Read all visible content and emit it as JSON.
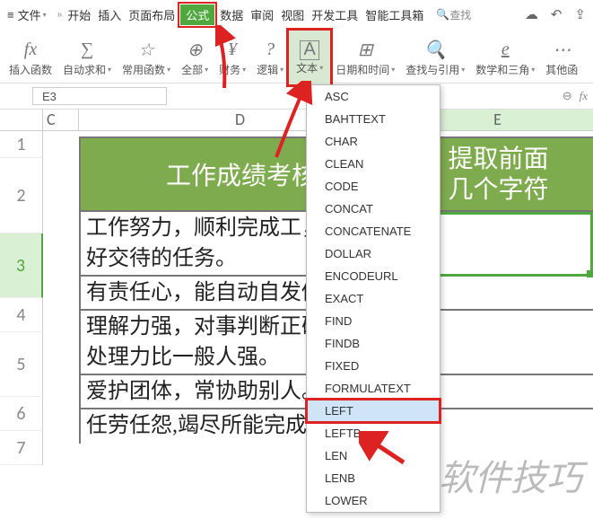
{
  "menubar": {
    "file": "文件",
    "tabs": [
      "开始",
      "插入",
      "页面布局",
      "公式",
      "数据",
      "审阅",
      "视图",
      "开发工具",
      "智能工具箱"
    ],
    "active_tab": "公式",
    "search_placeholder": "查找"
  },
  "ribbon": {
    "insert_fn": "插入函数",
    "auto_sum": "自动求和",
    "recent": "常用函数",
    "all": "全部",
    "finance": "财务",
    "logic": "逻辑",
    "text": "文本",
    "date_time": "日期和时间",
    "lookup": "查找与引用",
    "math": "数学和三角",
    "other": "其他函"
  },
  "name_box": {
    "value": "E3"
  },
  "columns": {
    "c": "C",
    "d": "D",
    "e": "E"
  },
  "row_numbers": [
    "1",
    "2",
    "3",
    "4",
    "5",
    "6",
    "7"
  ],
  "green_header": {
    "d": "工作成绩考核",
    "e": "提取前面\n几个字符"
  },
  "data_rows": {
    "r3": "工作努力，顺利完成工，又快又好交待的任务。",
    "r4": "有责任心，能自动自发做事。",
    "r5": "理解力强，对事判断正确，状况处理力比一般人强。",
    "r6": "爱护团体，常协助别人。",
    "r7": "任劳任怨,竭尽所能完成任务。"
  },
  "dropdown": {
    "items": [
      "ASC",
      "BAHTTEXT",
      "CHAR",
      "CLEAN",
      "CODE",
      "CONCAT",
      "CONCATENATE",
      "DOLLAR",
      "ENCODEURL",
      "EXACT",
      "FIND",
      "FINDB",
      "FIXED",
      "FORMULATEXT",
      "LEFT",
      "LEFTB",
      "LEN",
      "LENB",
      "LOWER"
    ],
    "hover": "LEFT"
  },
  "watermark": "软件技巧"
}
